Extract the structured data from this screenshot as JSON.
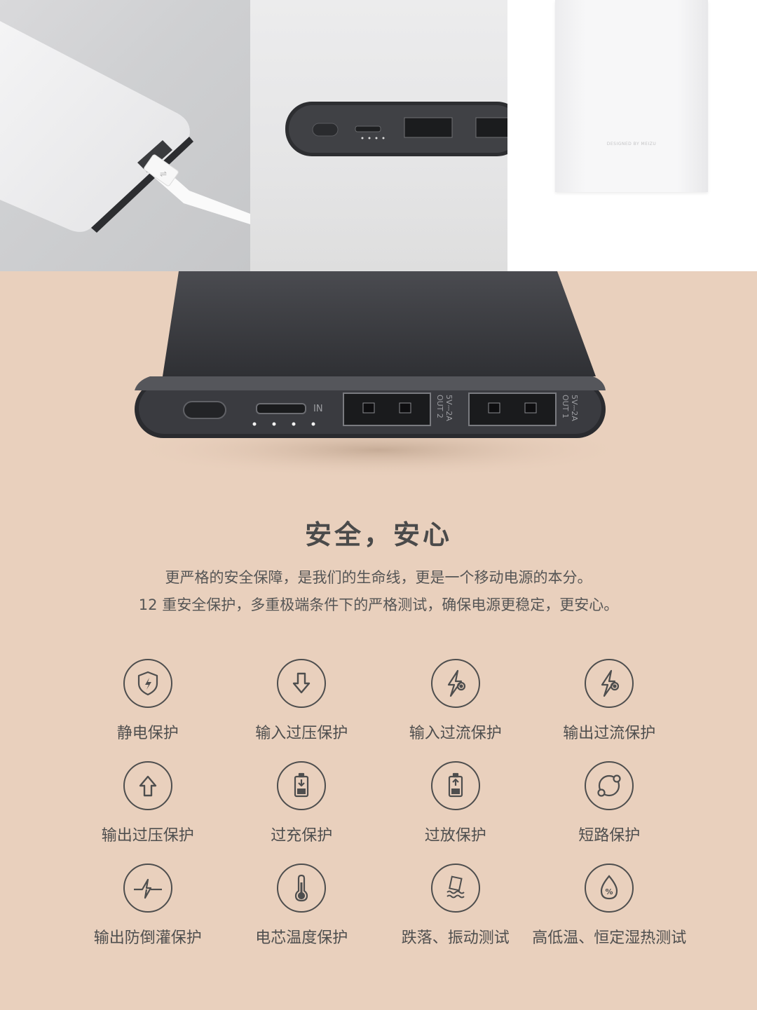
{
  "photos": {
    "device_text": "DESIGNED BY MEIZU",
    "port_labels": {
      "in": "IN",
      "out2": "OUT 2",
      "out2_spec": "5V⎓2A",
      "out1": "OUT 1",
      "out1_spec": "5V⎓2A"
    }
  },
  "section": {
    "title": "安全，安心",
    "desc_line1": "更严格的安全保障，是我们的生命线，更是一个移动电源的本分。",
    "desc_line2": "12 重安全保护，多重极端条件下的严格测试，确保电源更稳定，更安心。"
  },
  "features": [
    {
      "icon": "shield-bolt-icon",
      "label": "静电保护"
    },
    {
      "icon": "arrow-down-icon",
      "label": "输入过压保护"
    },
    {
      "icon": "bolt-current-icon",
      "label": "输入过流保护"
    },
    {
      "icon": "bolt-current-icon",
      "label": "输出过流保护"
    },
    {
      "icon": "arrow-up-icon",
      "label": "输出过压保护"
    },
    {
      "icon": "battery-charge-icon",
      "label": "过充保护"
    },
    {
      "icon": "battery-discharge-icon",
      "label": "过放保护"
    },
    {
      "icon": "short-circuit-icon",
      "label": "短路保护"
    },
    {
      "icon": "reverse-current-icon",
      "label": "输出防倒灌保护"
    },
    {
      "icon": "thermometer-icon",
      "label": "电芯温度保护"
    },
    {
      "icon": "drop-vibration-icon",
      "label": "跌落、振动测试"
    },
    {
      "icon": "humidity-icon",
      "label": "高低温、恒定湿热测试"
    }
  ],
  "colors": {
    "background": "#e9d0bd",
    "text": "#4e4e4e",
    "device_dark": "#2e2f33",
    "device_silver": "#e6e6e8"
  }
}
